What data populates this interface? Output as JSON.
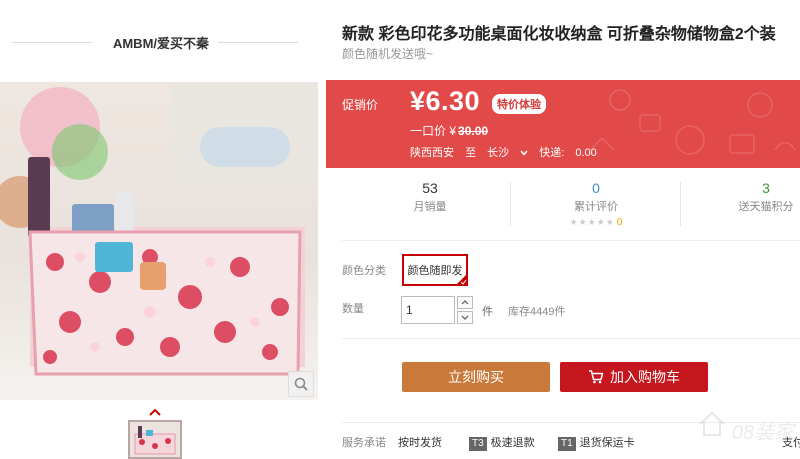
{
  "shop": {
    "name": "AMBM/爱买不秦"
  },
  "product": {
    "title": "新款 彩色印花多功能桌面化妆收纳盒 可折叠杂物储物盒2个装",
    "subtitle": "颜色随机发送哦~"
  },
  "price": {
    "promo_label": "促销价",
    "promo_price": "¥6.30",
    "badge": "特价体验",
    "original_label": "一口价",
    "original_currency": "¥",
    "original_price": "30.00",
    "shipping": {
      "origin": "陕西西安",
      "to_label": "至",
      "destination": "长沙",
      "fee_label": "快递:",
      "fee": "0.00"
    }
  },
  "stats": {
    "monthly_sales": {
      "value": "53",
      "label": "月销量"
    },
    "reviews": {
      "value": "0",
      "label": "累计评价",
      "stars": "★★★★★",
      "score": "0"
    },
    "points": {
      "value": "3",
      "label": "送天猫积分"
    }
  },
  "options": {
    "color_label": "颜色分类",
    "color_value": "颜色随即发",
    "quantity_label": "数量",
    "quantity_value": "1",
    "unit": "件",
    "stock": "库存4449件"
  },
  "buttons": {
    "buy_now": "立刻购买",
    "add_to_cart": "加入购物车"
  },
  "services": {
    "label": "服务承诺",
    "items": [
      {
        "tag": "",
        "text": "按时发货"
      },
      {
        "tag": "T3",
        "text": "极速退款"
      },
      {
        "tag": "T1",
        "text": "退货保运卡"
      },
      {
        "tag": "",
        "text": "支付"
      }
    ]
  },
  "watermark": {
    "text": "08装家"
  },
  "colors": {
    "price_bg": "#e24a4a",
    "buy_button": "#c97a3b",
    "cart_button": "#c4161c",
    "selected_border": "#c40000",
    "reviews_blue": "#3a8ec7",
    "points_green": "#3d9a3d"
  },
  "icons": {
    "zoom": "magnifier-icon",
    "thumb_prev": "chevron-up-icon",
    "dropdown": "chevron-down-icon",
    "qty_up": "triangle-up-icon",
    "qty_down": "triangle-down-icon",
    "cart": "cart-icon",
    "selected": "check-corner-icon"
  }
}
